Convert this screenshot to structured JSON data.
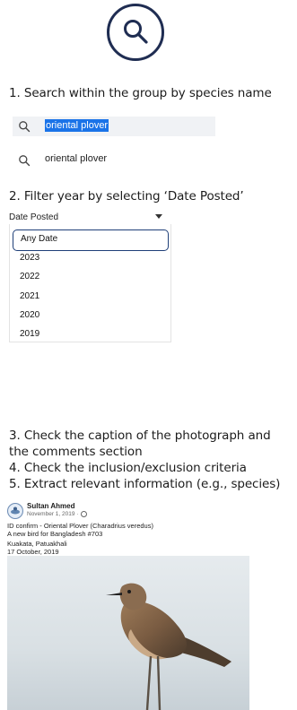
{
  "steps": {
    "s1": "1. Search within the group by species name",
    "s2": "2. Filter year by selecting ‘Date Posted’",
    "s3a": "3. Check the caption of the photograph and",
    "s3b": "the comments section",
    "s4": "4. Check the inclusion/exclusion criteria",
    "s5": "5. Extract relevant information (e.g., species)"
  },
  "search": {
    "query": "oriental plover",
    "suggestion": "oriental plover",
    "big_icon": "search-icon"
  },
  "filter": {
    "label": "Date Posted",
    "options": [
      "Any Date",
      "2023",
      "2022",
      "2021",
      "2020",
      "2019"
    ],
    "selected": "Any Date"
  },
  "post": {
    "author": "Sultan Ahmed",
    "date": "November 1, 2019 ·",
    "caption": [
      "ID confirm - Oriental Plover (Charadrius veredus)",
      "A new bird for Bangladesh #703",
      "Kuakata, Patuakhali",
      "17 October, 2019"
    ]
  },
  "colors": {
    "icon_ring": "#1f2d52",
    "selection": "#1a73e8",
    "dropdown_selected_border": "#1f3f78"
  }
}
